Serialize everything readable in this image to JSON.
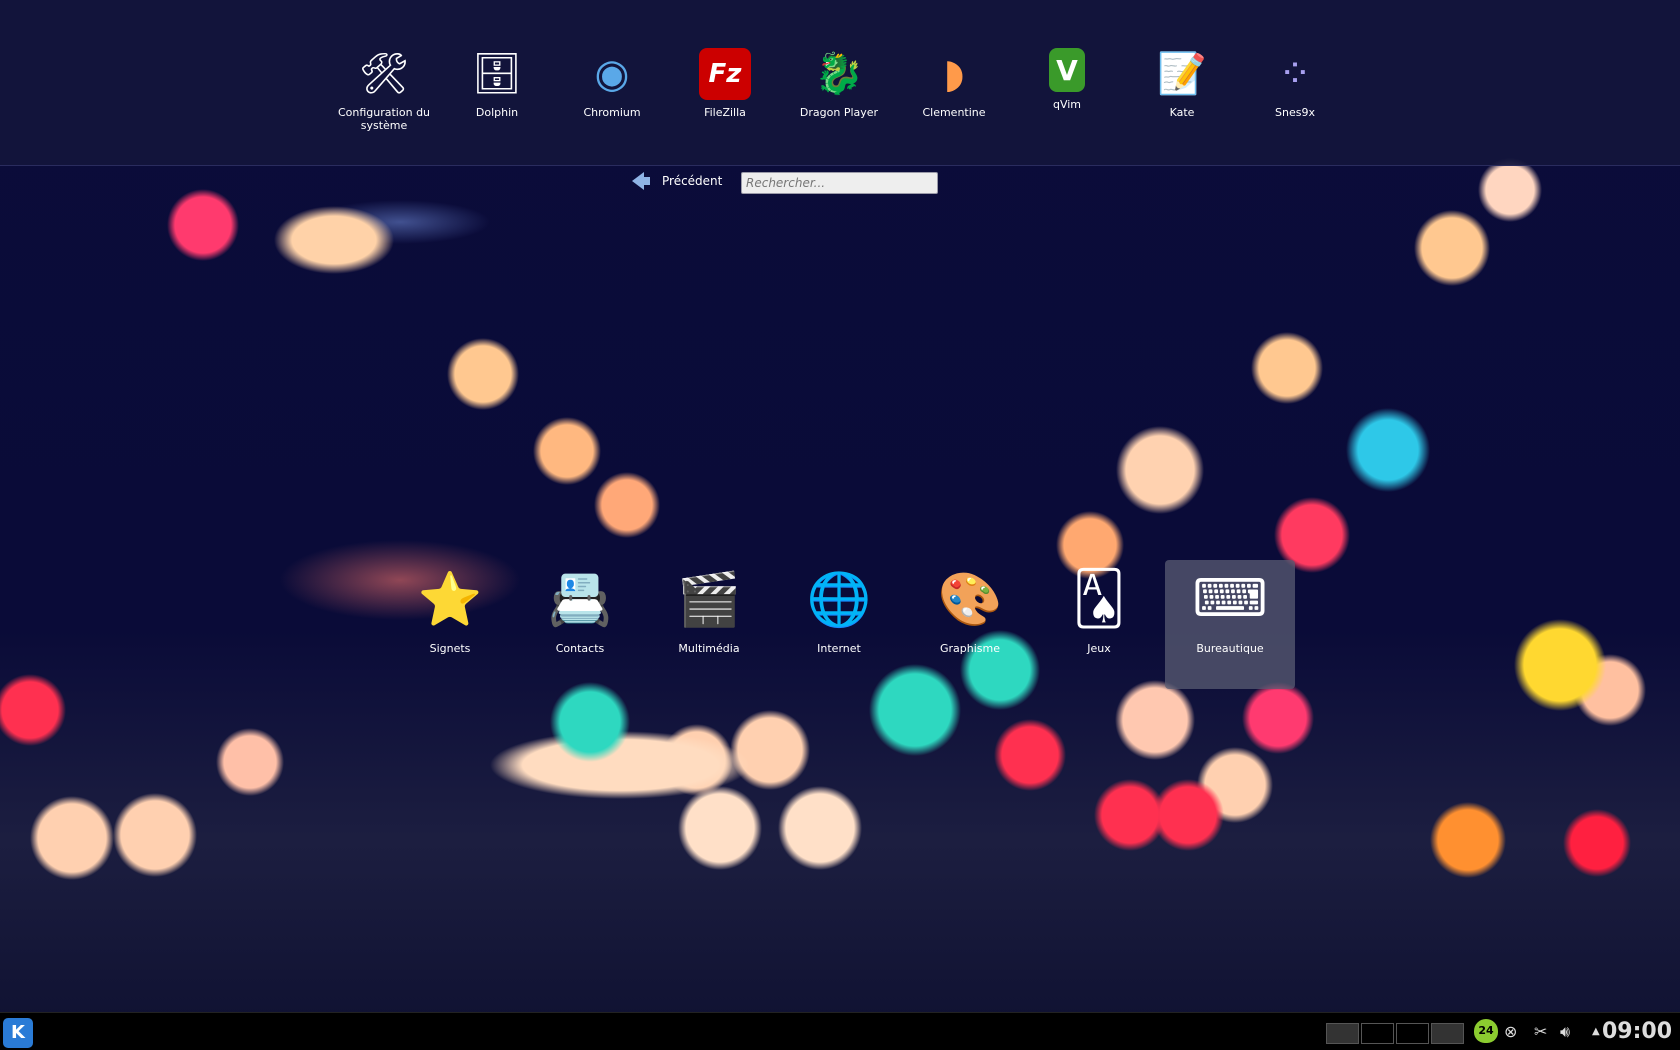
{
  "favorites": [
    {
      "label": "Configuration du système",
      "icon": "tools-icon",
      "glyph": "🛠"
    },
    {
      "label": "Dolphin",
      "icon": "file-manager-icon",
      "glyph": "🗄"
    },
    {
      "label": "Chromium",
      "icon": "chromium-icon",
      "glyph": "◉"
    },
    {
      "label": "FileZilla",
      "icon": "filezilla-icon",
      "glyph": "Fz"
    },
    {
      "label": "Dragon Player",
      "icon": "dragon-player-icon",
      "glyph": "🐉"
    },
    {
      "label": "Clementine",
      "icon": "clementine-icon",
      "glyph": "◗"
    },
    {
      "label": "qVim",
      "icon": "vim-icon",
      "glyph": "V"
    },
    {
      "label": "Kate",
      "icon": "kate-icon",
      "glyph": "📝"
    },
    {
      "label": "Snes9x",
      "icon": "snes9x-icon",
      "glyph": "⁘"
    }
  ],
  "nav": {
    "back_label": "Précédent",
    "search_placeholder": "Rechercher..."
  },
  "categories": [
    {
      "label": "Signets",
      "icon": "star-icon",
      "glyph": "⭐"
    },
    {
      "label": "Contacts",
      "icon": "contacts-icon",
      "glyph": "📇"
    },
    {
      "label": "Multimédia",
      "icon": "multimedia-icon",
      "glyph": "🎬"
    },
    {
      "label": "Internet",
      "icon": "globe-icon",
      "glyph": "🌐"
    },
    {
      "label": "Graphisme",
      "icon": "palette-icon",
      "glyph": "🎨"
    },
    {
      "label": "Jeux",
      "icon": "cards-icon",
      "glyph": "🂡"
    },
    {
      "label": "Bureautique",
      "icon": "typewriter-icon",
      "glyph": "⌨",
      "selected": true
    }
  ],
  "taskbar": {
    "kickoff": "K",
    "update_badge": "24",
    "clock": "09:00"
  }
}
